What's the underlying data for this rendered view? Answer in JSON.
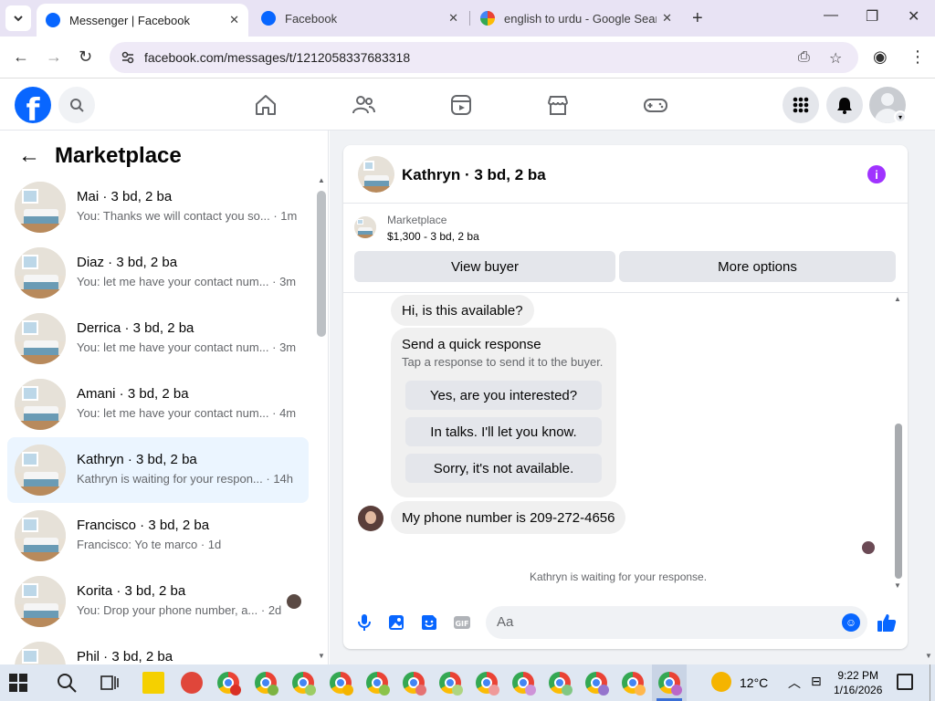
{
  "browser": {
    "tabs": [
      {
        "title": "Messenger | Facebook",
        "active": true
      },
      {
        "title": "Facebook",
        "active": false
      },
      {
        "title": "english to urdu - Google Search",
        "active": false
      }
    ],
    "url": "facebook.com/messages/t/1212058337683318"
  },
  "marketplace": {
    "title": "Marketplace",
    "conversations": [
      {
        "title": "Mai · 3 bd, 2 ba",
        "preview": "You: Thanks we will contact you so... · 1m",
        "selected": false
      },
      {
        "title": "Diaz · 3 bd, 2 ba",
        "preview": "You: let me have your contact num... · 3m",
        "selected": false
      },
      {
        "title": "Derrica · 3 bd, 2 ba",
        "preview": "You: let me have your contact num... · 3m",
        "selected": false
      },
      {
        "title": "Amani · 3 bd, 2 ba",
        "preview": "You: let me have your contact num... · 4m",
        "selected": false
      },
      {
        "title": "Kathryn · 3 bd, 2 ba",
        "preview": "Kathryn is waiting for your respon... · 14h",
        "selected": true
      },
      {
        "title": "Francisco · 3 bd, 2 ba",
        "preview": "Francisco: Yo te marco · 1d",
        "selected": false
      },
      {
        "title": "Korita · 3 bd, 2 ba",
        "preview": "You: Drop your phone number, a... · 2d",
        "selected": false
      },
      {
        "title": "Phil · 3 bd, 2 ba",
        "preview": "",
        "selected": false
      }
    ]
  },
  "chat": {
    "title": "Kathryn · 3 bd, 2 ba",
    "listing": {
      "label": "Marketplace",
      "price_line": "$1,300 - 3 bd, 2 ba",
      "view_buyer": "View buyer",
      "more_options": "More options"
    },
    "messages": {
      "first": "Hi, is this available?",
      "phone": "My phone number is 209-272-4656"
    },
    "quick_response": {
      "title": "Send a quick response",
      "subtitle": "Tap a response to send it to the buyer.",
      "options": [
        "Yes, are you interested?",
        "In talks. I'll let you know.",
        "Sorry, it's not available."
      ]
    },
    "waiting_note": "Kathryn is waiting for your response.",
    "composer_placeholder": "Aa"
  },
  "taskbar": {
    "temperature": "12°C",
    "time": "9:22 PM",
    "date": "1/16/2026"
  },
  "colors": {
    "facebook_blue": "#0866ff",
    "selected_row": "#ebf5ff",
    "info_purple": "#a033ff"
  }
}
